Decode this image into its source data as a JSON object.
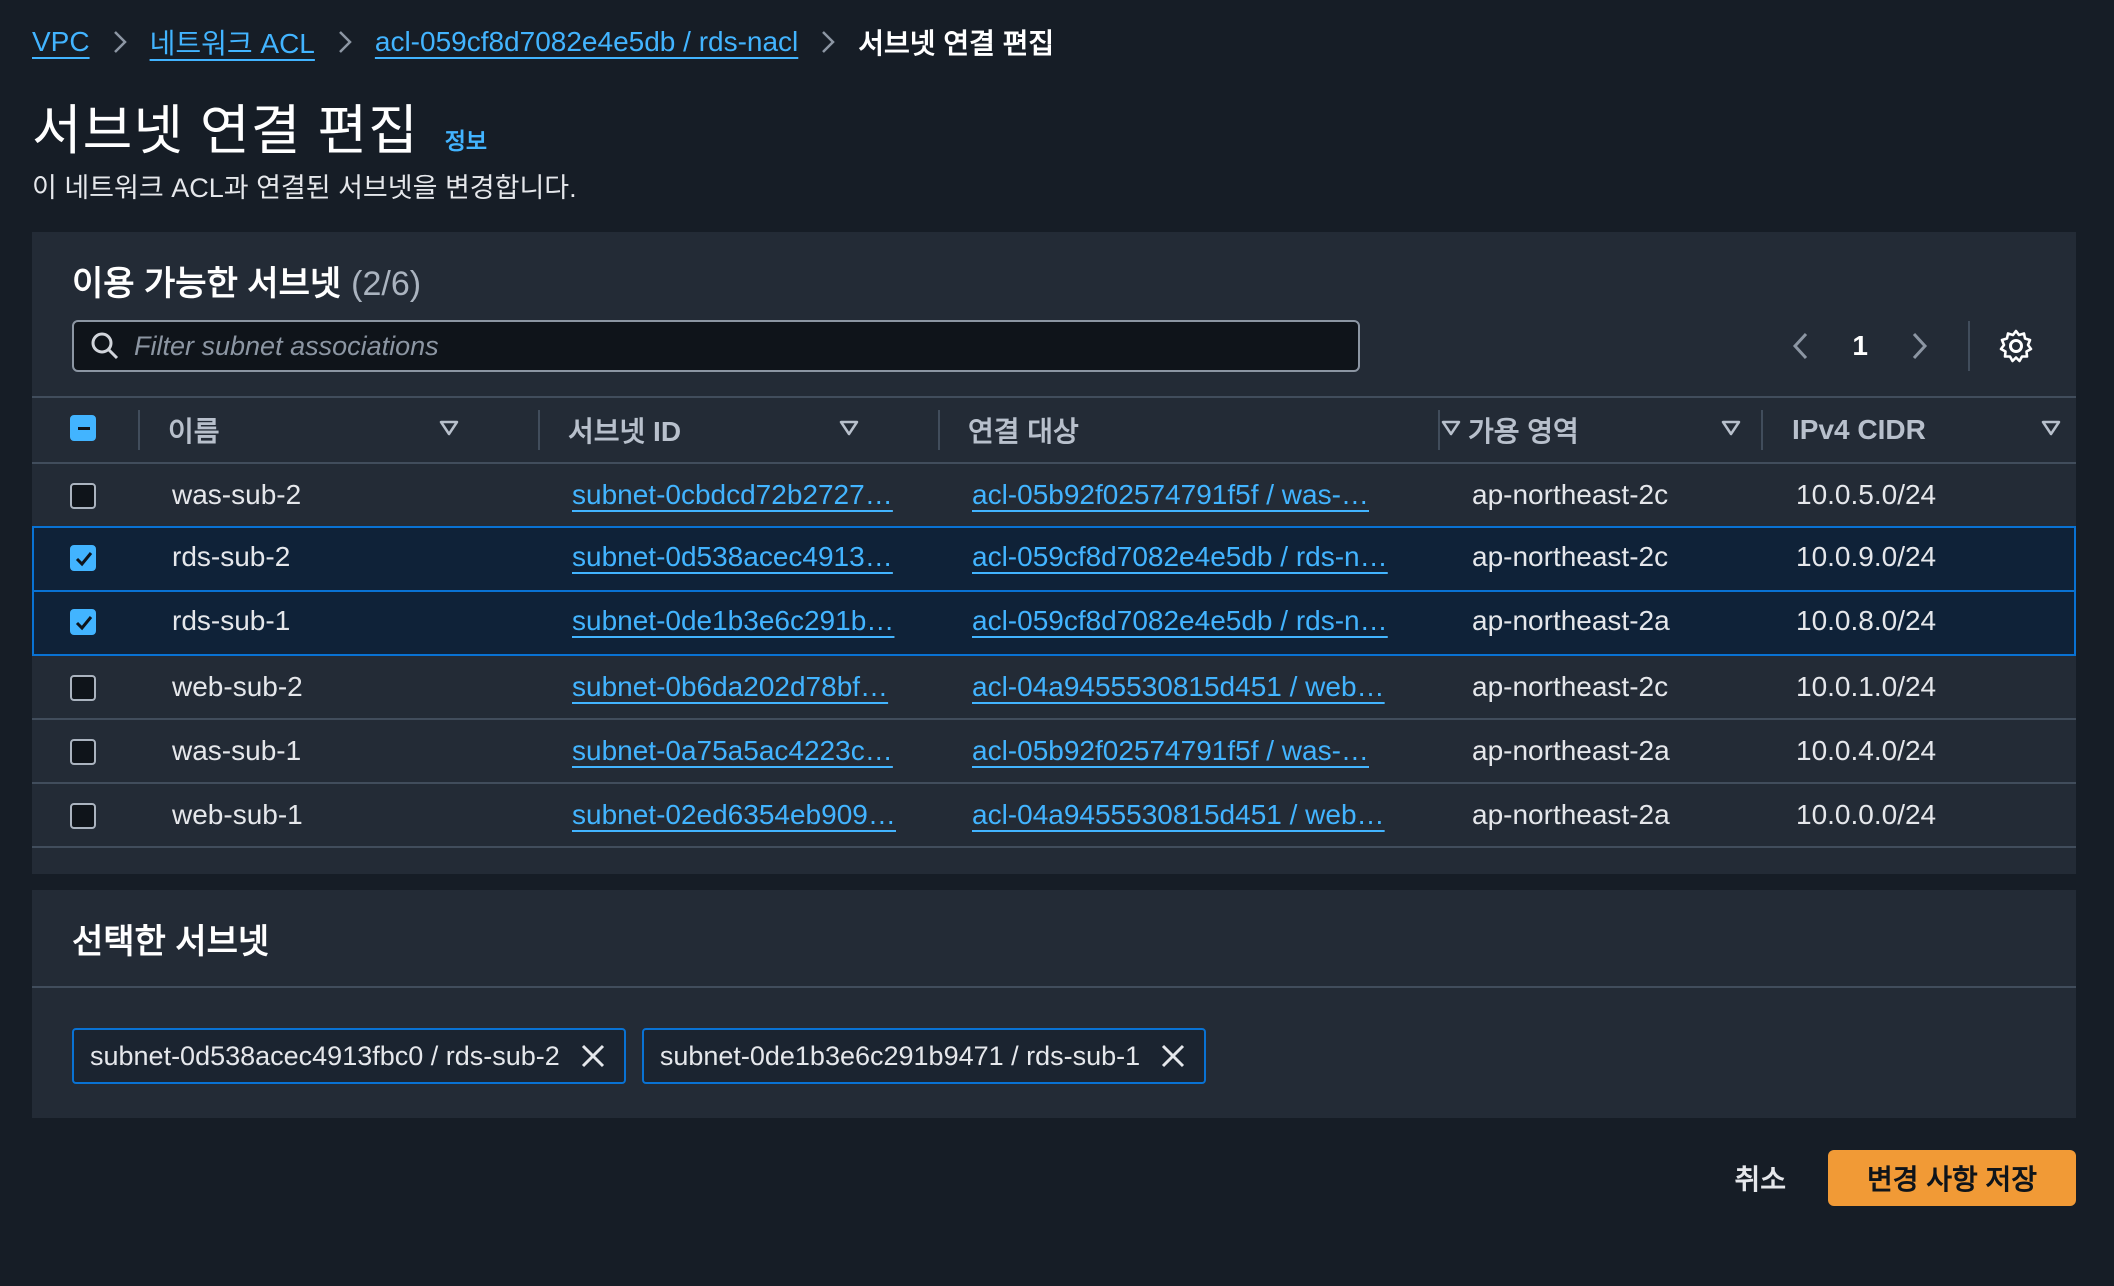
{
  "breadcrumb": {
    "items": [
      "VPC",
      "네트워크 ACL",
      "acl-059cf8d7082e4e5db / rds-nacl"
    ],
    "current": "서브넷 연결 편집"
  },
  "page": {
    "title": "서브넷 연결 편집",
    "info": "정보",
    "description": "이 네트워크 ACL과 연결된 서브넷을 변경합니다."
  },
  "available": {
    "header": "이용 가능한 서브넷",
    "count": "(2/6)",
    "search_placeholder": "Filter subnet associations",
    "page_number": "1",
    "columns": [
      "이름",
      "서브넷 ID",
      "연결 대상",
      "가용 영역",
      "IPv4 CIDR"
    ],
    "rows": [
      {
        "name": "was-sub-2",
        "subnet_id": "subnet-0cbdcd72b2727…",
        "associated_with": "acl-05b92f02574791f5f / was-…",
        "az": "ap-northeast-2c",
        "cidr": "10.0.5.0/24",
        "selected": false
      },
      {
        "name": "rds-sub-2",
        "subnet_id": "subnet-0d538acec4913…",
        "associated_with": "acl-059cf8d7082e4e5db / rds-n…",
        "az": "ap-northeast-2c",
        "cidr": "10.0.9.0/24",
        "selected": true
      },
      {
        "name": "rds-sub-1",
        "subnet_id": "subnet-0de1b3e6c291b…",
        "associated_with": "acl-059cf8d7082e4e5db / rds-n…",
        "az": "ap-northeast-2a",
        "cidr": "10.0.8.0/24",
        "selected": true
      },
      {
        "name": "web-sub-2",
        "subnet_id": "subnet-0b6da202d78bf…",
        "associated_with": "acl-04a9455530815d451 / web…",
        "az": "ap-northeast-2c",
        "cidr": "10.0.1.0/24",
        "selected": false
      },
      {
        "name": "was-sub-1",
        "subnet_id": "subnet-0a75a5ac4223c…",
        "associated_with": "acl-05b92f02574791f5f / was-…",
        "az": "ap-northeast-2a",
        "cidr": "10.0.4.0/24",
        "selected": false
      },
      {
        "name": "web-sub-1",
        "subnet_id": "subnet-02ed6354eb909…",
        "associated_with": "acl-04a9455530815d451 / web…",
        "az": "ap-northeast-2a",
        "cidr": "10.0.0.0/24",
        "selected": false
      }
    ]
  },
  "selected": {
    "header": "선택한 서브넷",
    "tokens": [
      "subnet-0d538acec4913fbc0 / rds-sub-2",
      "subnet-0de1b3e6c291b9471 / rds-sub-1"
    ]
  },
  "actions": {
    "cancel": "취소",
    "save": "변경 사항 저장"
  },
  "colors": {
    "background": "#161d26",
    "panel": "#232b36",
    "link": "#42b4ff",
    "primary": "#f19a36",
    "selected_row": "#0f2238"
  }
}
